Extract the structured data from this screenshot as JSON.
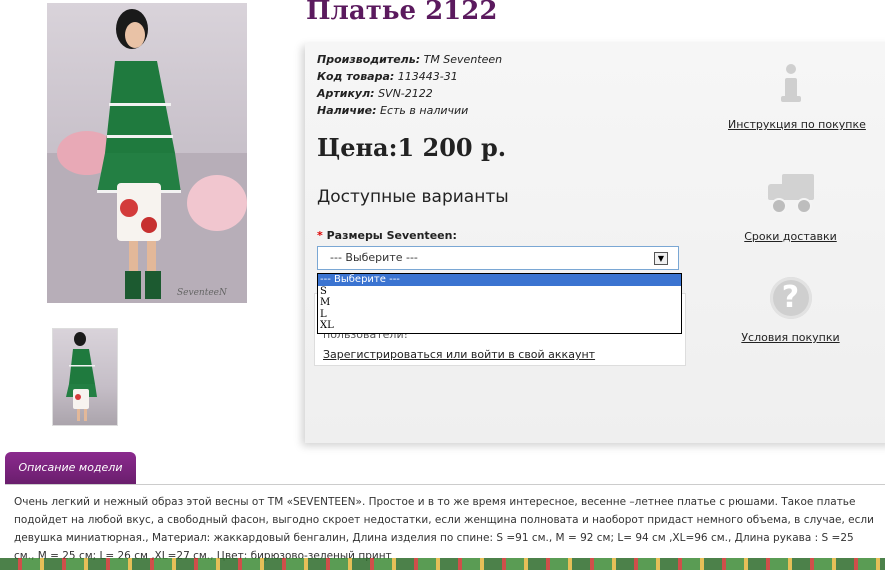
{
  "product": {
    "title": "Платье 2122",
    "manufacturer_label": "Производитель:",
    "manufacturer_value": "ТМ Seventeen",
    "code_label": "Код товара:",
    "code_value": "113443-31",
    "article_label": "Артикул:",
    "article_value": "SVN-2122",
    "availability_label": "Наличие:",
    "availability_value": "Есть в наличии",
    "price": "Цена:1 200 р."
  },
  "variants": {
    "title": "Доступные варианты",
    "required_mark": "*",
    "size_label": "Размеры Seventeen:",
    "select_value": "--- Выберите ---",
    "options": [
      "--- Выберите ---",
      "S",
      "M",
      "L",
      "XL"
    ]
  },
  "login": {
    "text": "пользователи!",
    "link": "Зарегистрироваться или войти в свой аккаунт"
  },
  "sidebar": {
    "purchase_instructions": "Инструкция по покупке",
    "delivery_terms": "Сроки доставки",
    "purchase_conditions": "Условия покупки"
  },
  "description": {
    "tab_label": "Описание модели",
    "text": "Очень легкий и нежный образ этой весны от ТМ «SEVENTEEN». Простое и в то же время интересное, весенне –летнее платье с рюшами. Такое платье подойдет на любой вкус, а свободный фасон, выгодно скроет недостатки, если женщина полновата и наоборот придаст немного объема, в случае, если девушка миниатюрная., Материал: жаккардовый бенгалин, Длина изделия по спине: S =91 см., M = 92 см; L= 94 см ,XL=96 см., Длина рукава : S =25 см., M = 25 см; L= 26 см ,XL=27 см., Цвет: бирюзово-зеленый принт"
  },
  "photo_signature": "SeventeeN",
  "colors": {
    "title": "#5b1a5e",
    "tab": "#7a237d",
    "select_highlight": "#3b74d1",
    "required": "#dd0000"
  }
}
